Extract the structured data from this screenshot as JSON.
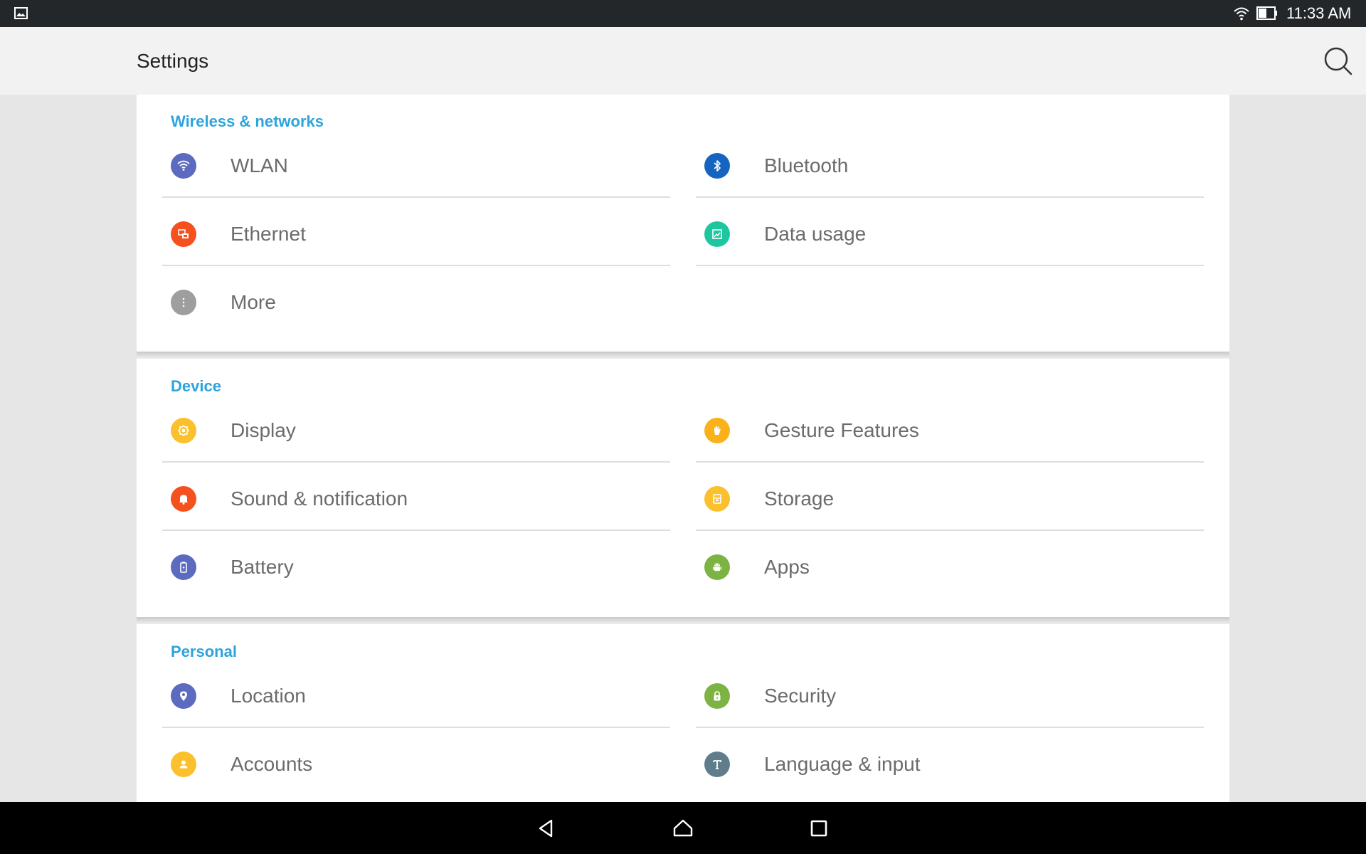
{
  "status_bar": {
    "time": "11:33 AM"
  },
  "app_bar": {
    "title": "Settings"
  },
  "sections": [
    {
      "title": "Wireless & networks",
      "items": [
        {
          "label": "WLAN",
          "icon": "wifi-icon",
          "color": "#5c6bc0"
        },
        {
          "label": "Bluetooth",
          "icon": "bluetooth-icon",
          "color": "#1565c0"
        },
        {
          "label": "Ethernet",
          "icon": "ethernet-icon",
          "color": "#f4511e"
        },
        {
          "label": "Data usage",
          "icon": "data-usage-icon",
          "color": "#1ec6a0"
        },
        {
          "label": "More",
          "icon": "more-icon",
          "color": "#9e9e9e"
        }
      ]
    },
    {
      "title": "Device",
      "items": [
        {
          "label": "Display",
          "icon": "display-icon",
          "color": "#fbc02d"
        },
        {
          "label": "Gesture Features",
          "icon": "gesture-icon",
          "color": "#fbb11a"
        },
        {
          "label": "Sound & notification",
          "icon": "bell-icon",
          "color": "#f4511e"
        },
        {
          "label": "Storage",
          "icon": "storage-icon",
          "color": "#fbc02d"
        },
        {
          "label": "Battery",
          "icon": "battery-icon",
          "color": "#5c6bc0"
        },
        {
          "label": "Apps",
          "icon": "android-icon",
          "color": "#7cb342"
        }
      ]
    },
    {
      "title": "Personal",
      "items": [
        {
          "label": "Location",
          "icon": "location-icon",
          "color": "#5c6bc0"
        },
        {
          "label": "Security",
          "icon": "lock-icon",
          "color": "#7cb342"
        },
        {
          "label": "Accounts",
          "icon": "account-icon",
          "color": "#fbc02d"
        },
        {
          "label": "Language & input",
          "icon": "language-icon",
          "color": "#607d8b"
        }
      ]
    }
  ]
}
